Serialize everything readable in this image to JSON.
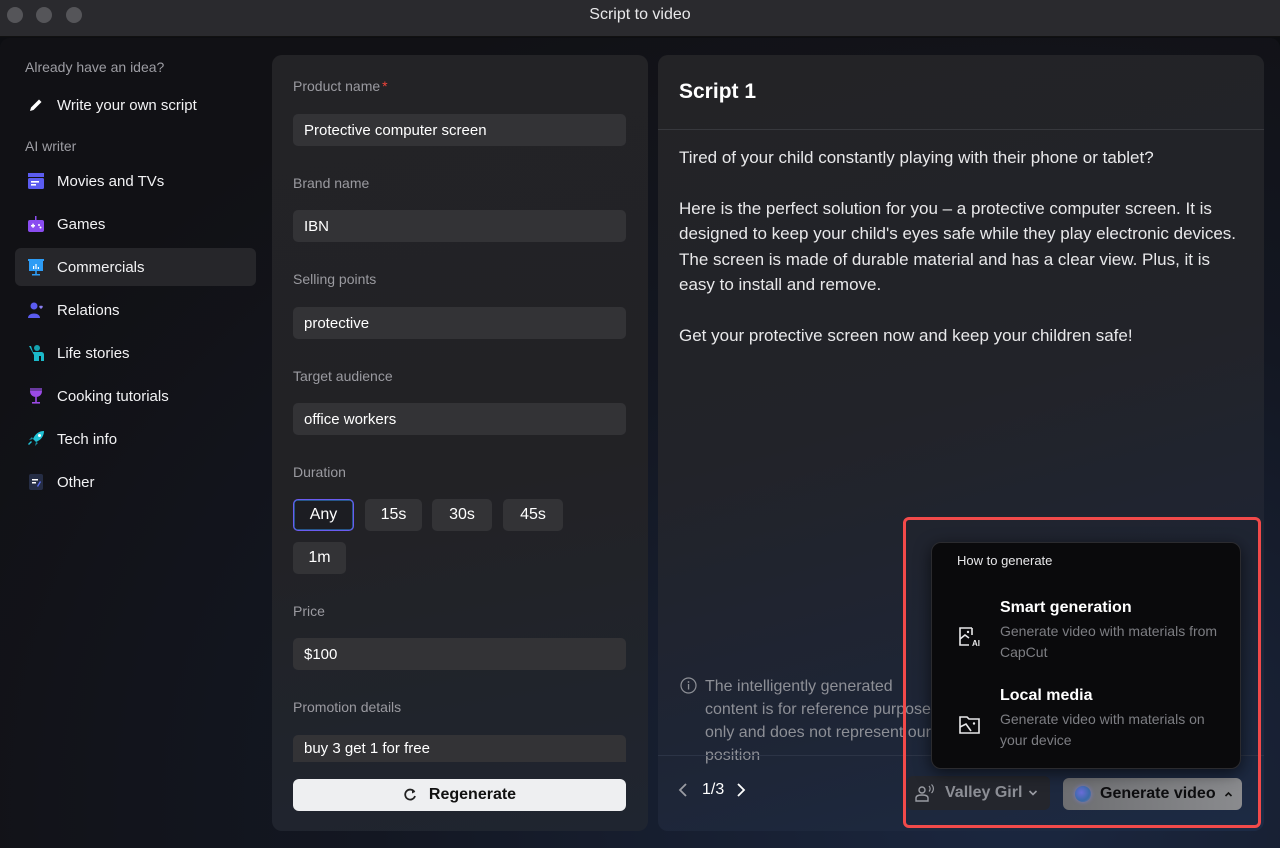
{
  "window": {
    "title": "Script to video"
  },
  "sidebar": {
    "idea_label": "Already have an idea?",
    "write_own": "Write your own script",
    "ai_writer_label": "AI writer",
    "items": [
      {
        "label": "Movies and TVs",
        "icon": "clapperboard-icon",
        "color": "#5b5cf0"
      },
      {
        "label": "Games",
        "icon": "gamepad-icon",
        "color": "#8a4cf0"
      },
      {
        "label": "Commercials",
        "icon": "presentation-icon",
        "color": "#2d9cf5",
        "active": true
      },
      {
        "label": "Relations",
        "icon": "people-heart-icon",
        "color": "#5b5cf0"
      },
      {
        "label": "Life stories",
        "icon": "waving-person-icon",
        "color": "#1bb9c9"
      },
      {
        "label": "Cooking tutorials",
        "icon": "wine-glass-icon",
        "color": "#9b4ae6"
      },
      {
        "label": "Tech info",
        "icon": "rocket-icon",
        "color": "#22c3d6"
      },
      {
        "label": "Other",
        "icon": "note-edit-icon",
        "color": "#2d3a5a"
      }
    ]
  },
  "form": {
    "product_name": {
      "label": "Product name",
      "required_mark": "*",
      "value": "Protective computer screen"
    },
    "brand_name": {
      "label": "Brand name",
      "value": "IBN"
    },
    "selling_points": {
      "label": "Selling points",
      "value": "protective"
    },
    "target_audience": {
      "label": "Target audience",
      "value": "office workers"
    },
    "duration": {
      "label": "Duration",
      "options": [
        "Any",
        "15s",
        "30s",
        "45s",
        "1m"
      ],
      "selected": "Any"
    },
    "price": {
      "label": "Price",
      "value": "$100"
    },
    "promotion": {
      "label": "Promotion details",
      "value": "buy 3 get 1 for free"
    },
    "regenerate_label": "Regenerate"
  },
  "script": {
    "title": "Script 1",
    "paragraphs": [
      "Tired of your child constantly playing with their phone or tablet?",
      "Here is the perfect solution for you – a protective computer screen. It is designed to keep your child's eyes safe while they play electronic devices. The screen is made of durable material and has a clear view. Plus, it is easy to install and remove.",
      "Get your protective screen now and keep your children safe!"
    ],
    "notice": "The intelligently generated content is for reference purposes only and does not represent our position",
    "pager": "1/3",
    "voice": "Valley Girl",
    "generate_label": "Generate video"
  },
  "popover": {
    "title": "How to generate",
    "items": [
      {
        "title": "Smart generation",
        "desc": "Generate video with materials from CapCut",
        "icon": "ai-image-icon"
      },
      {
        "title": "Local media",
        "desc": "Generate video with materials on your device",
        "icon": "folder-image-icon"
      }
    ]
  },
  "colors": {
    "highlight": "#f24a4a",
    "accent": "#6a5cf0",
    "required": "#f0443a"
  }
}
